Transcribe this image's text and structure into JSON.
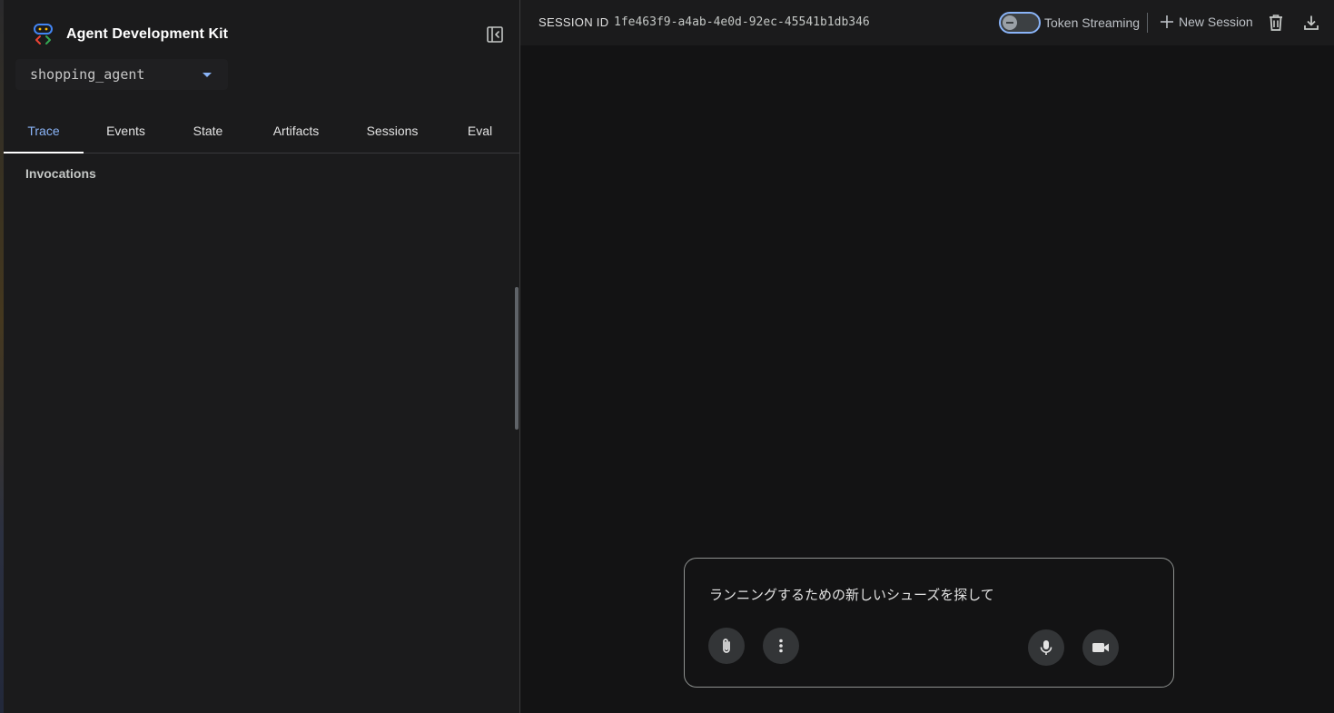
{
  "app": {
    "title": "Agent Development Kit",
    "agent_selected": "shopping_agent"
  },
  "sidebar": {
    "tabs": [
      {
        "label": "Trace",
        "active": true
      },
      {
        "label": "Events",
        "active": false
      },
      {
        "label": "State",
        "active": false
      },
      {
        "label": "Artifacts",
        "active": false
      },
      {
        "label": "Sessions",
        "active": false
      },
      {
        "label": "Eval",
        "active": false
      }
    ],
    "section_title": "Invocations"
  },
  "topbar": {
    "session_label": "SESSION ID",
    "session_id": "1fe463f9-a4ab-4e0d-92ec-45541b1db346",
    "token_streaming_label": "Token Streaming",
    "token_streaming_enabled": false,
    "new_session_label": "New Session"
  },
  "composer": {
    "input_value": "ランニングするための新しいシューズを探して"
  },
  "colors": {
    "accent": "#8ab4f8",
    "sidebar_bg": "#1b1b1c",
    "main_bg": "#131314",
    "button_bg": "#333537"
  },
  "icons": {
    "logo": "adk-logo-icon",
    "collapse": "sidebar-collapse-icon",
    "dropdown": "chevron-down-icon",
    "new_session": "plus-icon",
    "delete": "trash-icon",
    "download": "download-icon",
    "attach": "paperclip-icon",
    "more": "more-vert-icon",
    "mic": "mic-icon",
    "video": "videocam-icon"
  }
}
